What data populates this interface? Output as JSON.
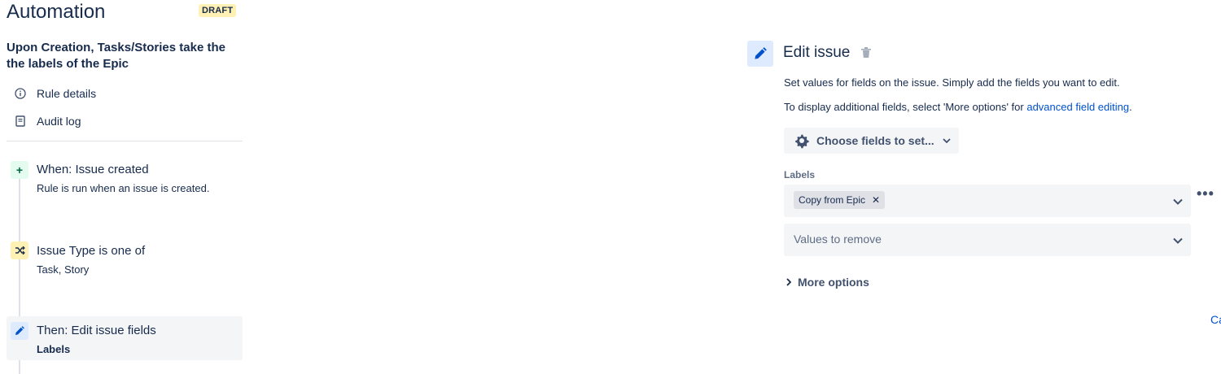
{
  "header": {
    "title": "Automation",
    "status_badge": "DRAFT"
  },
  "rule": {
    "name": "Upon Creation, Tasks/Stories take the the labels of the Epic"
  },
  "side_nav": [
    {
      "label": "Rule details",
      "icon": "info-icon"
    },
    {
      "label": "Audit log",
      "icon": "document-icon"
    }
  ],
  "steps": [
    {
      "title": "When: Issue created",
      "subtitle": "Rule is run when an issue is created.",
      "icon": "plus-icon",
      "icon_color": "#006644",
      "icon_bg": "#e3fcef"
    },
    {
      "title": "Issue Type is one of",
      "subtitle": "Task, Story",
      "icon": "shuffle-icon",
      "icon_color": "#172b4d",
      "icon_bg": "#fff0b3"
    },
    {
      "title": "Then: Edit issue fields",
      "subtitle": "Labels",
      "icon": "pencil-icon",
      "icon_color": "#0052cc",
      "icon_bg": "#deebff"
    }
  ],
  "editor": {
    "title": "Edit issue",
    "description": "Set values for fields on the issue. Simply add the fields you want to edit.",
    "hint_prefix": "To display additional fields, select 'More options' for ",
    "hint_link": "advanced field editing",
    "hint_suffix": ".",
    "choose_fields_label": "Choose fields to set...",
    "labels_field_label": "Labels",
    "selected_tag": "Copy from Epic",
    "remove_placeholder": "Values to remove",
    "more_options_label": "More options",
    "cancel_partial": "Ca"
  },
  "colors": {
    "accent": "#0052cc",
    "badge_bg": "#fff0b3",
    "active_step_bg": "#f4f5f7"
  }
}
